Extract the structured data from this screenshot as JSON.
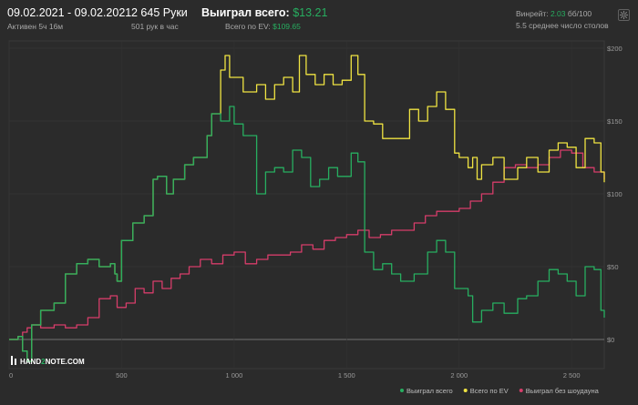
{
  "header": {
    "date_range": "09.02.2021 - 09.02.2021",
    "active_time": "Активен 5ч 16м",
    "hands": "2 645 Руки",
    "hands_per_hour": "501 рук в час",
    "won_total_label": "Выиграл всего:",
    "won_total_value": "$13.21",
    "ev_label": "Всего по EV:",
    "ev_value": "$109.65",
    "winrate_label": "Винрейт:",
    "winrate_value": "2.03",
    "winrate_suffix": "бб/100",
    "avg_players": "5.5 среднее число столов"
  },
  "watermark": {
    "brand_left": "HAND",
    "brand_mid": "2",
    "brand_right": "NOTE.COM"
  },
  "colors": {
    "won": "#27ae60",
    "ev": "#f0e442",
    "showdown": "#d63d6a",
    "accent": "#27ae60"
  },
  "icons": {
    "settings": "gear-icon"
  },
  "chart_data": {
    "type": "line",
    "xlim": [
      0,
      2645
    ],
    "ylim": [
      -20,
      205
    ],
    "x_ticks": [
      0,
      500,
      1000,
      1500,
      2000,
      2500
    ],
    "x_tick_labels": [
      "0",
      "500",
      "1 000",
      "1 500",
      "2 000",
      "2 500"
    ],
    "y_ticks": [
      0,
      50,
      100,
      150,
      200
    ],
    "y_tick_labels": [
      "$0",
      "$50",
      "$100",
      "$150",
      "$200"
    ],
    "grid": true,
    "legend_position": "bottom-right",
    "series": [
      {
        "name": "Выиграл всего",
        "color": "#27ae60",
        "points": [
          [
            0,
            0
          ],
          [
            40,
            2
          ],
          [
            60,
            -8
          ],
          [
            80,
            -15
          ],
          [
            100,
            10
          ],
          [
            140,
            20
          ],
          [
            200,
            25
          ],
          [
            250,
            45
          ],
          [
            300,
            52
          ],
          [
            350,
            55
          ],
          [
            400,
            50
          ],
          [
            450,
            52
          ],
          [
            470,
            45
          ],
          [
            480,
            40
          ],
          [
            500,
            68
          ],
          [
            520,
            68
          ],
          [
            550,
            80
          ],
          [
            600,
            85
          ],
          [
            640,
            110
          ],
          [
            660,
            112
          ],
          [
            700,
            100
          ],
          [
            730,
            110
          ],
          [
            780,
            120
          ],
          [
            820,
            125
          ],
          [
            880,
            140
          ],
          [
            900,
            155
          ],
          [
            940,
            150
          ],
          [
            980,
            160
          ],
          [
            1000,
            148
          ],
          [
            1040,
            140
          ],
          [
            1080,
            140
          ],
          [
            1100,
            100
          ],
          [
            1140,
            115
          ],
          [
            1180,
            118
          ],
          [
            1220,
            115
          ],
          [
            1260,
            130
          ],
          [
            1300,
            125
          ],
          [
            1340,
            105
          ],
          [
            1380,
            110
          ],
          [
            1420,
            118
          ],
          [
            1460,
            112
          ],
          [
            1520,
            128
          ],
          [
            1550,
            122
          ],
          [
            1580,
            60
          ],
          [
            1620,
            48
          ],
          [
            1660,
            52
          ],
          [
            1700,
            45
          ],
          [
            1740,
            40
          ],
          [
            1800,
            45
          ],
          [
            1860,
            60
          ],
          [
            1900,
            68
          ],
          [
            1940,
            60
          ],
          [
            1980,
            35
          ],
          [
            2000,
            35
          ],
          [
            2040,
            30
          ],
          [
            2060,
            12
          ],
          [
            2100,
            20
          ],
          [
            2150,
            25
          ],
          [
            2200,
            18
          ],
          [
            2260,
            28
          ],
          [
            2300,
            30
          ],
          [
            2350,
            40
          ],
          [
            2400,
            48
          ],
          [
            2440,
            45
          ],
          [
            2480,
            40
          ],
          [
            2520,
            30
          ],
          [
            2560,
            50
          ],
          [
            2600,
            48
          ],
          [
            2630,
            20
          ],
          [
            2645,
            15
          ]
        ]
      },
      {
        "name": "Всего по EV",
        "color": "#f0e442",
        "points": [
          [
            0,
            0
          ],
          [
            40,
            2
          ],
          [
            60,
            -8
          ],
          [
            80,
            -15
          ],
          [
            100,
            10
          ],
          [
            140,
            20
          ],
          [
            200,
            25
          ],
          [
            250,
            45
          ],
          [
            300,
            52
          ],
          [
            350,
            55
          ],
          [
            400,
            50
          ],
          [
            450,
            52
          ],
          [
            470,
            45
          ],
          [
            480,
            40
          ],
          [
            500,
            68
          ],
          [
            520,
            68
          ],
          [
            550,
            80
          ],
          [
            600,
            85
          ],
          [
            640,
            110
          ],
          [
            660,
            112
          ],
          [
            700,
            100
          ],
          [
            730,
            110
          ],
          [
            780,
            120
          ],
          [
            820,
            125
          ],
          [
            880,
            140
          ],
          [
            900,
            155
          ],
          [
            940,
            185
          ],
          [
            960,
            195
          ],
          [
            980,
            180
          ],
          [
            1000,
            180
          ],
          [
            1040,
            170
          ],
          [
            1080,
            170
          ],
          [
            1100,
            175
          ],
          [
            1140,
            165
          ],
          [
            1180,
            175
          ],
          [
            1220,
            180
          ],
          [
            1260,
            170
          ],
          [
            1290,
            195
          ],
          [
            1320,
            182
          ],
          [
            1360,
            175
          ],
          [
            1400,
            182
          ],
          [
            1440,
            175
          ],
          [
            1480,
            178
          ],
          [
            1520,
            195
          ],
          [
            1550,
            182
          ],
          [
            1580,
            150
          ],
          [
            1620,
            148
          ],
          [
            1660,
            138
          ],
          [
            1700,
            138
          ],
          [
            1740,
            138
          ],
          [
            1780,
            158
          ],
          [
            1820,
            150
          ],
          [
            1860,
            160
          ],
          [
            1900,
            170
          ],
          [
            1940,
            158
          ],
          [
            1980,
            128
          ],
          [
            2000,
            125
          ],
          [
            2040,
            118
          ],
          [
            2060,
            125
          ],
          [
            2080,
            110
          ],
          [
            2100,
            120
          ],
          [
            2150,
            125
          ],
          [
            2200,
            110
          ],
          [
            2260,
            118
          ],
          [
            2300,
            125
          ],
          [
            2350,
            115
          ],
          [
            2400,
            130
          ],
          [
            2440,
            135
          ],
          [
            2480,
            132
          ],
          [
            2520,
            118
          ],
          [
            2560,
            138
          ],
          [
            2600,
            135
          ],
          [
            2630,
            115
          ],
          [
            2645,
            108
          ]
        ]
      },
      {
        "name": "Выиграл без шоудауна",
        "color": "#d63d6a",
        "points": [
          [
            0,
            0
          ],
          [
            40,
            2
          ],
          [
            60,
            5
          ],
          [
            80,
            8
          ],
          [
            100,
            10
          ],
          [
            140,
            8
          ],
          [
            200,
            10
          ],
          [
            250,
            8
          ],
          [
            300,
            10
          ],
          [
            350,
            15
          ],
          [
            400,
            28
          ],
          [
            450,
            30
          ],
          [
            480,
            22
          ],
          [
            520,
            25
          ],
          [
            560,
            35
          ],
          [
            600,
            32
          ],
          [
            640,
            40
          ],
          [
            680,
            35
          ],
          [
            720,
            42
          ],
          [
            760,
            45
          ],
          [
            800,
            50
          ],
          [
            850,
            55
          ],
          [
            900,
            52
          ],
          [
            950,
            58
          ],
          [
            1000,
            60
          ],
          [
            1050,
            52
          ],
          [
            1100,
            55
          ],
          [
            1150,
            58
          ],
          [
            1200,
            58
          ],
          [
            1250,
            60
          ],
          [
            1300,
            65
          ],
          [
            1350,
            62
          ],
          [
            1400,
            68
          ],
          [
            1450,
            70
          ],
          [
            1500,
            72
          ],
          [
            1550,
            75
          ],
          [
            1600,
            70
          ],
          [
            1650,
            72
          ],
          [
            1700,
            75
          ],
          [
            1750,
            75
          ],
          [
            1800,
            80
          ],
          [
            1850,
            85
          ],
          [
            1900,
            88
          ],
          [
            1950,
            88
          ],
          [
            2000,
            90
          ],
          [
            2050,
            95
          ],
          [
            2100,
            100
          ],
          [
            2150,
            108
          ],
          [
            2200,
            118
          ],
          [
            2250,
            120
          ],
          [
            2300,
            118
          ],
          [
            2350,
            120
          ],
          [
            2400,
            125
          ],
          [
            2450,
            130
          ],
          [
            2500,
            128
          ],
          [
            2550,
            118
          ],
          [
            2600,
            115
          ],
          [
            2645,
            110
          ]
        ]
      }
    ]
  }
}
